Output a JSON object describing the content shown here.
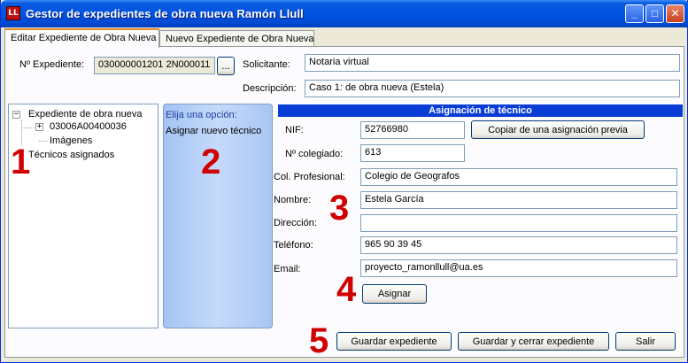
{
  "window": {
    "title": "Gestor de expedientes de obra nueva Ramón Llull",
    "app_icon": "LL",
    "minimize": "_",
    "maximize": "□",
    "close": "✕"
  },
  "tabs": [
    {
      "label": "Editar Expediente de Obra Nueva",
      "active": true
    },
    {
      "label": "Nuevo Expediente de Obra Nueva",
      "active": false
    }
  ],
  "header": {
    "expediente_label": "Nº Expediente:",
    "expediente_value": "030000001201 2N000011",
    "browse_label": "...",
    "solicitante_label": "Solicitante:",
    "solicitante_value": "Notaria virtual",
    "descripcion_label": "Descripción:",
    "descripcion_value": "Caso 1: de obra nueva (Estela)"
  },
  "tree": {
    "root": "Expediente de obra nueva",
    "child": "03006A00400036",
    "images": "Imágenes",
    "tecnicos": "Técnicos asignados",
    "expand_minus": "−",
    "expand_plus": "+"
  },
  "options": {
    "title": "Elija una opción:",
    "link": "Asignar nuevo técnico"
  },
  "assignment": {
    "title": "Asignación de técnico",
    "nif_label": "NIF:",
    "nif_value": "52766980",
    "copy_button": "Copiar de una asignación previa",
    "colegiado_label": "Nº colegiado:",
    "colegiado_value": "613",
    "colprof_label": "Col. Profesional:",
    "colprof_value": "Colegio de Geografos",
    "nombre_label": "Nombre:",
    "nombre_value": "Estela García",
    "direccion_label": "Dirección:",
    "direccion_value": "",
    "telefono_label": "Teléfono:",
    "telefono_value": "965 90 39 45",
    "email_label": "Email:",
    "email_value": "proyecto_ramonllull@ua.es",
    "assign_button": "Asignar"
  },
  "footer": {
    "save_button": "Guardar expediente",
    "save_close_button": "Guardar y cerrar expediente",
    "exit_button": "Salir"
  },
  "annotations": [
    "1",
    "2",
    "3",
    "4",
    "5"
  ],
  "colors": {
    "titlebar": "#0053e1",
    "section_header": "#0a3cd6",
    "annotation": "#d00000",
    "options_panel": "#b4d0f7"
  }
}
